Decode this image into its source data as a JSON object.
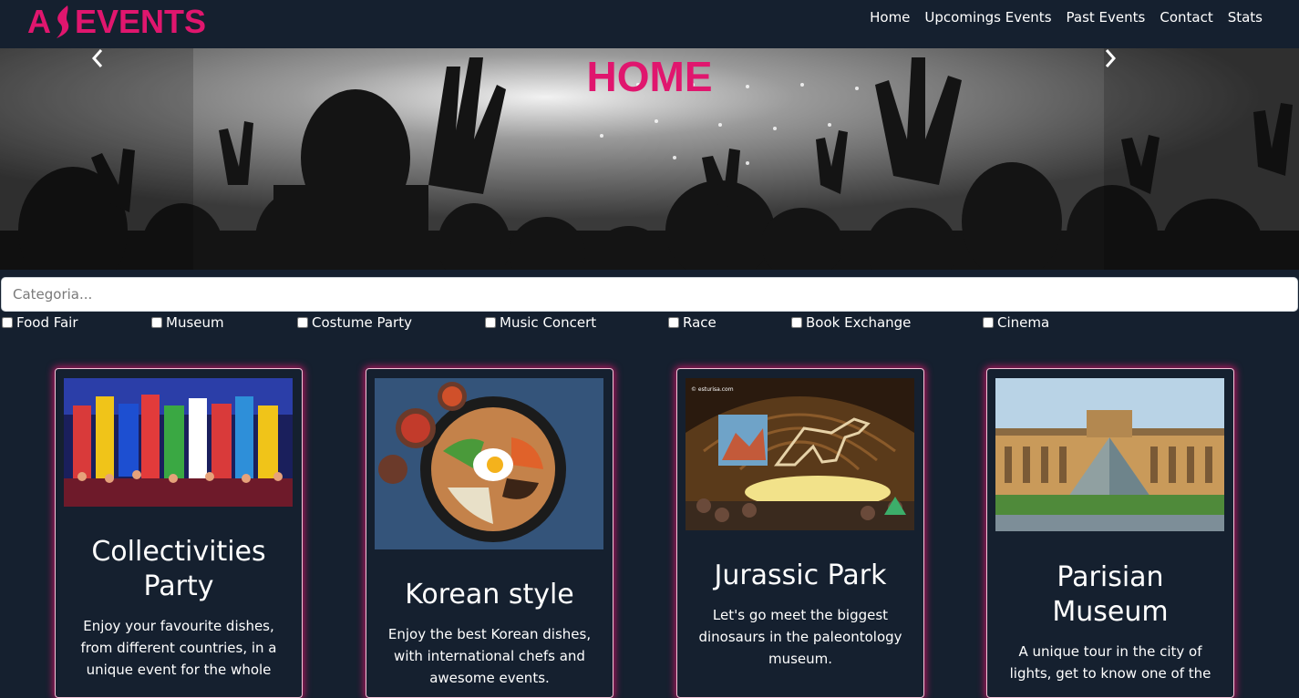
{
  "brand": {
    "name": "EVENTS",
    "accent_color": "#e0166e"
  },
  "nav": [
    {
      "label": "Home"
    },
    {
      "label": "Upcomings Events"
    },
    {
      "label": "Past Events"
    },
    {
      "label": "Contact"
    },
    {
      "label": "Stats"
    }
  ],
  "hero": {
    "title": "HOME",
    "prev_icon": "chevron-left-icon",
    "next_icon": "chevron-right-icon"
  },
  "filter": {
    "placeholder": "Categoria...",
    "categories": [
      {
        "label": "Food Fair",
        "checked": false
      },
      {
        "label": "Museum",
        "checked": false
      },
      {
        "label": "Costume Party",
        "checked": false
      },
      {
        "label": "Music Concert",
        "checked": false
      },
      {
        "label": "Race",
        "checked": false
      },
      {
        "label": "Book Exchange",
        "checked": false
      },
      {
        "label": "Cinema",
        "checked": false
      }
    ]
  },
  "cards": [
    {
      "title_lines": [
        "Collectivities",
        "Party"
      ],
      "desc_lines": [
        "Enjoy your favourite dishes,",
        "from different countries, in a",
        "unique event for the whole"
      ]
    },
    {
      "title_lines": [
        "Korean style"
      ],
      "desc_lines": [
        "Enjoy the best Korean dishes,",
        "with international chefs and",
        "awesome events."
      ]
    },
    {
      "title_lines": [
        "Jurassic Park"
      ],
      "desc_lines": [
        "Let's go meet the biggest",
        "dinosaurs in the paleontology",
        "museum."
      ],
      "image_watermark": "© esturisa.com"
    },
    {
      "title_lines": [
        "Parisian",
        "Museum"
      ],
      "desc_lines": [
        "A unique tour in the city of",
        "lights, get to know one of the"
      ]
    }
  ]
}
